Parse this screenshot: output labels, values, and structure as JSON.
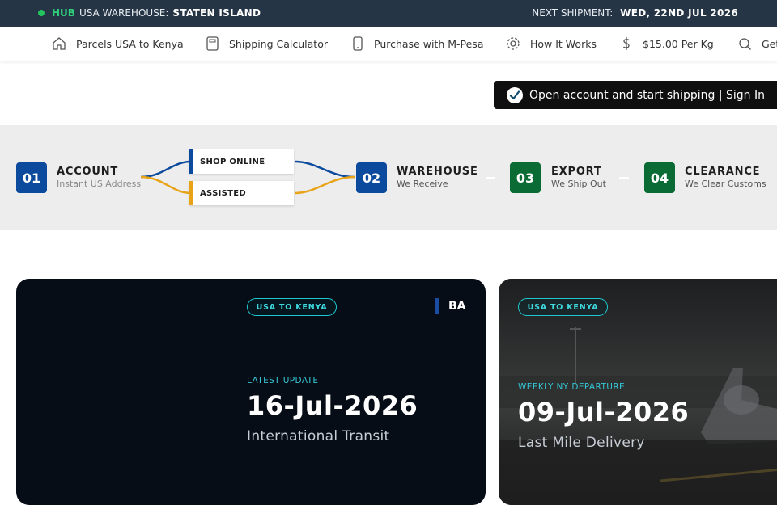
{
  "topbar": {
    "hub_tag": "HUB",
    "warehouse_label": "USA WAREHOUSE:",
    "warehouse_value": "STATEN ISLAND",
    "shipment_label": "NEXT SHIPMENT:",
    "shipment_value": "WED, 22ND JUL 2026"
  },
  "nav": {
    "items": [
      {
        "label": "Parcels USA to Kenya",
        "icon": "home-icon"
      },
      {
        "label": "Shipping Calculator",
        "icon": "calculator-icon"
      },
      {
        "label": "Purchase with M-Pesa",
        "icon": "phone-icon"
      },
      {
        "label": "How It Works",
        "icon": "gear-icon"
      },
      {
        "label": "$15.00 Per Kg",
        "icon": "dollar-icon"
      },
      {
        "label": "Get",
        "icon": "search-icon"
      }
    ]
  },
  "signin": {
    "label": "Open account and start shipping | Sign In"
  },
  "process": {
    "steps": [
      {
        "num": "01",
        "title": "ACCOUNT",
        "sub": "Instant US Address",
        "color": "#0b4a9c"
      },
      {
        "num": "02",
        "title": "WAREHOUSE",
        "sub": "We Receive",
        "color": "#0b4a9c"
      },
      {
        "num": "03",
        "title": "EXPORT",
        "sub": "We Ship Out",
        "color": "#0a6b34"
      },
      {
        "num": "04",
        "title": "CLEARANCE",
        "sub": "We Clear Customs",
        "color": "#0a6b34"
      }
    ],
    "choices": [
      {
        "label": "SHOP ONLINE",
        "color": "#0b4a9c"
      },
      {
        "label": "ASSISTED",
        "color": "#e8a317"
      }
    ]
  },
  "cards": [
    {
      "badge": "USA TO KENYA",
      "tag": "BA",
      "kicker": "LATEST UPDATE",
      "date": "16-Jul-2026",
      "status": "International Transit"
    },
    {
      "badge": "USA TO KENYA",
      "kicker": "WEEKLY NY DEPARTURE",
      "date": "09-Jul-2026",
      "status": "Last Mile Delivery"
    }
  ]
}
